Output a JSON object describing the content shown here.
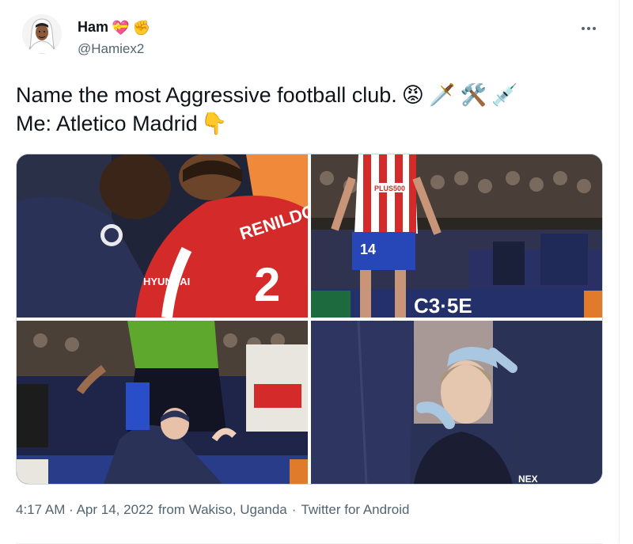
{
  "author": {
    "display_name": "Ham",
    "name_emojis": [
      "💝",
      "✊"
    ],
    "handle": "@Hamiex2"
  },
  "tweet": {
    "line1_text": "Name the most Aggressive football club.",
    "line1_emojis": [
      "😡",
      "🗡️",
      "🛠️",
      "💉"
    ],
    "line2_text": "Me: Atletico Madrid",
    "line2_emojis": [
      "👇"
    ]
  },
  "photos": {
    "top_left": {
      "jersey_text": "RENILDO",
      "sponsor_text": "HYUNDAI"
    },
    "top_right": {
      "jersey_number": "14",
      "sponsor_text": "PLUS500"
    },
    "bottom_left": {},
    "bottom_right": {
      "sponsor_text": "NEX"
    }
  },
  "meta": {
    "time": "4:17 AM",
    "sep1": "·",
    "date": "Apr 14, 2022",
    "location": "from Wakiso, Uganda",
    "sep2": "·",
    "source": "Twitter for Android"
  },
  "colors": {
    "text": "#0f1419",
    "secondary": "#536471",
    "atletico_red": "#d52a2a",
    "city_navy": "#2b3257"
  }
}
